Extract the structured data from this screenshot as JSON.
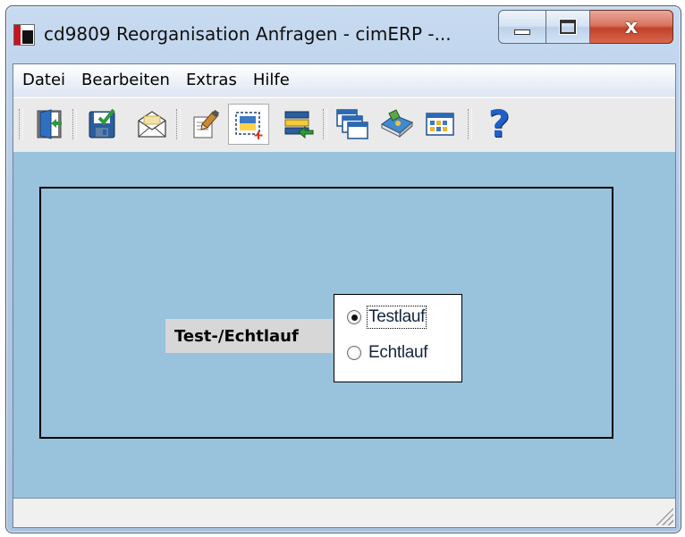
{
  "window": {
    "title": "cd9809 Reorganisation Anfragen - cimERP -...",
    "caption_buttons": {
      "minimize_icon": "minimize-icon",
      "maximize_icon": "maximize-icon",
      "close_icon": "close-icon",
      "close_glyph": "x"
    }
  },
  "menu": {
    "items": [
      {
        "label": "Datei"
      },
      {
        "label": "Bearbeiten"
      },
      {
        "label": "Extras"
      },
      {
        "label": "Hilfe"
      }
    ]
  },
  "toolbar": {
    "buttons": [
      {
        "icon": "exit-door-icon"
      },
      {
        "icon": "save-disk-icon"
      },
      {
        "icon": "mail-envelope-icon"
      },
      {
        "icon": "edit-document-icon"
      },
      {
        "icon": "select-area-icon",
        "active": true
      },
      {
        "icon": "list-arrow-icon"
      },
      {
        "icon": "windows-cascade-icon"
      },
      {
        "icon": "book-icon"
      },
      {
        "icon": "calendar-grid-icon"
      },
      {
        "icon": "help-icon",
        "glyph": "?"
      }
    ]
  },
  "form": {
    "field_label": "Test-/Echtlauf",
    "options": [
      {
        "label": "Testlauf",
        "selected": true
      },
      {
        "label": "Echtlauf",
        "selected": false
      }
    ]
  },
  "status": {
    "text": ""
  },
  "colors": {
    "content_background": "#99c2dc",
    "accent_close": "#c2412a",
    "label_background": "#d7d7d7"
  }
}
